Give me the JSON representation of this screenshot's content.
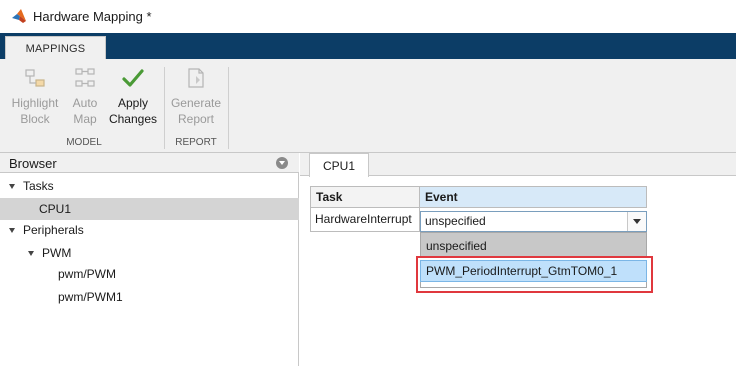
{
  "window": {
    "title": "Hardware Mapping *",
    "app_icon": "matlab-logo-icon"
  },
  "ribbon": {
    "tabs": [
      {
        "label": "MAPPINGS",
        "active": true
      }
    ],
    "groups": [
      {
        "label": "MODEL",
        "tools": [
          {
            "line1": "Highlight",
            "line2": "Block",
            "icon": "highlight-block-icon",
            "enabled": false
          },
          {
            "line1": "Auto",
            "line2": "Map",
            "icon": "auto-map-icon",
            "enabled": false
          },
          {
            "line1": "Apply",
            "line2": "Changes",
            "icon": "checkmark-icon",
            "enabled": true
          }
        ]
      },
      {
        "label": "REPORT",
        "tools": [
          {
            "line1": "Generate",
            "line2": "Report",
            "icon": "generate-report-icon",
            "enabled": false
          }
        ]
      }
    ],
    "colors": {
      "strip": "#0c3d66",
      "check_green": "#4a9a36"
    }
  },
  "browser": {
    "title": "Browser",
    "tree": [
      {
        "label": "Tasks",
        "level": 0,
        "expanded": true
      },
      {
        "label": "CPU1",
        "level": 1,
        "selected": true
      },
      {
        "label": "Peripherals",
        "level": 0,
        "expanded": true
      },
      {
        "label": "PWM",
        "level": 1,
        "expanded": true
      },
      {
        "label": "pwm/PWM",
        "level": 2
      },
      {
        "label": "pwm/PWM1",
        "level": 2
      }
    ]
  },
  "editor": {
    "tab": "CPU1",
    "columns": [
      "Task",
      "Event"
    ],
    "rows": [
      {
        "task": "HardwareInterrupt",
        "event": "unspecified"
      }
    ],
    "dropdown": {
      "options": [
        "unspecified",
        "PWM_PeriodInterrupt_GtmTOM0_1"
      ],
      "highlighted": "PWM_PeriodInterrupt_GtmTOM0_1",
      "highlight_color": "#e0383e"
    }
  }
}
